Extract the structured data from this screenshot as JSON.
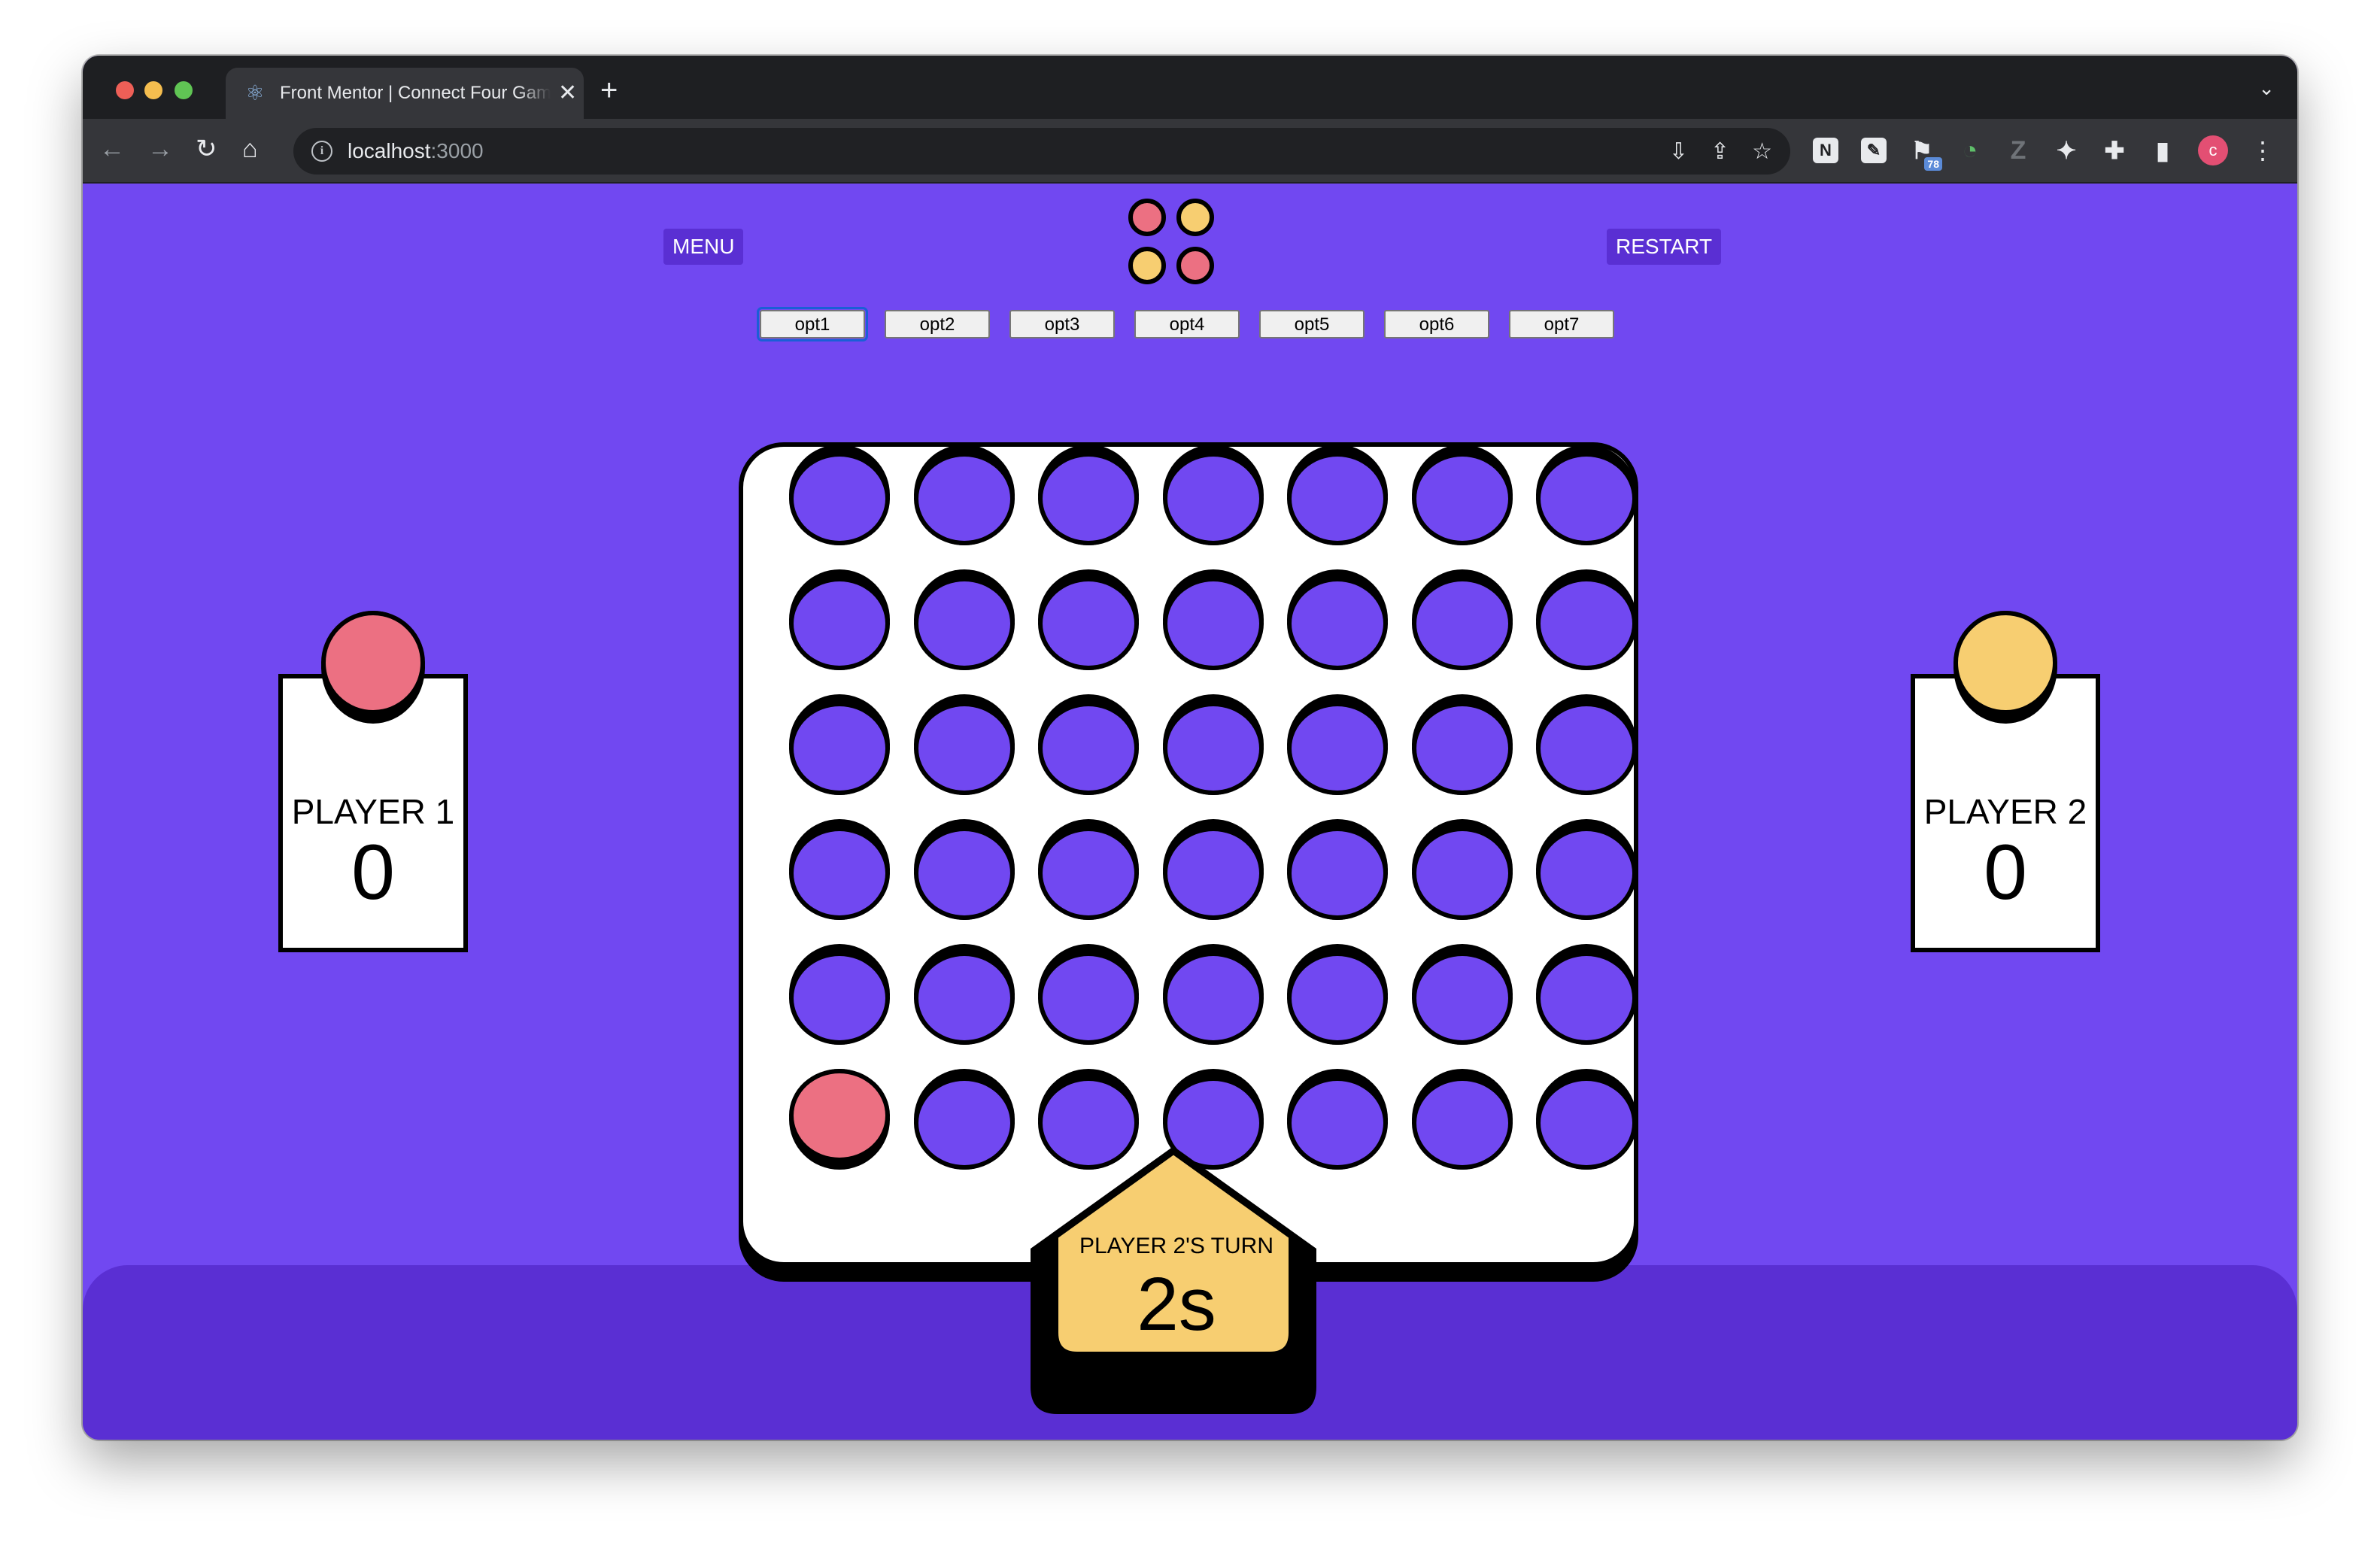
{
  "browser": {
    "tab_title": "Front Mentor | Connect Four Game",
    "url_host": "localhost",
    "url_port": ":3000",
    "extension_badge": "78",
    "profile_initial": "c"
  },
  "game": {
    "menu_label": "MENU",
    "restart_label": "RESTART",
    "column_options": [
      "opt1",
      "opt2",
      "opt3",
      "opt4",
      "opt5",
      "opt6",
      "opt7"
    ],
    "focused_option": "opt1",
    "players": [
      {
        "name": "PLAYER 1",
        "score": "0",
        "color": "#ec7082"
      },
      {
        "name": "PLAYER 2",
        "score": "0",
        "color": "#f7ce71"
      }
    ],
    "turn": {
      "label": "PLAYER 2'S TURN",
      "timer": "2s",
      "color": "#f7ce71"
    },
    "board": {
      "rows": 6,
      "columns": 7,
      "empty_color": "#7148f1",
      "grid": [
        [
          0,
          0,
          0,
          0,
          0,
          0,
          0
        ],
        [
          0,
          0,
          0,
          0,
          0,
          0,
          0
        ],
        [
          0,
          0,
          0,
          0,
          0,
          0,
          0
        ],
        [
          0,
          0,
          0,
          0,
          0,
          0,
          0
        ],
        [
          0,
          0,
          0,
          0,
          0,
          0,
          0
        ],
        [
          1,
          0,
          0,
          0,
          0,
          0,
          0
        ]
      ]
    },
    "logo_colors": [
      "#ec7082",
      "#f7ce71",
      "#f7ce71",
      "#ec7082"
    ]
  }
}
